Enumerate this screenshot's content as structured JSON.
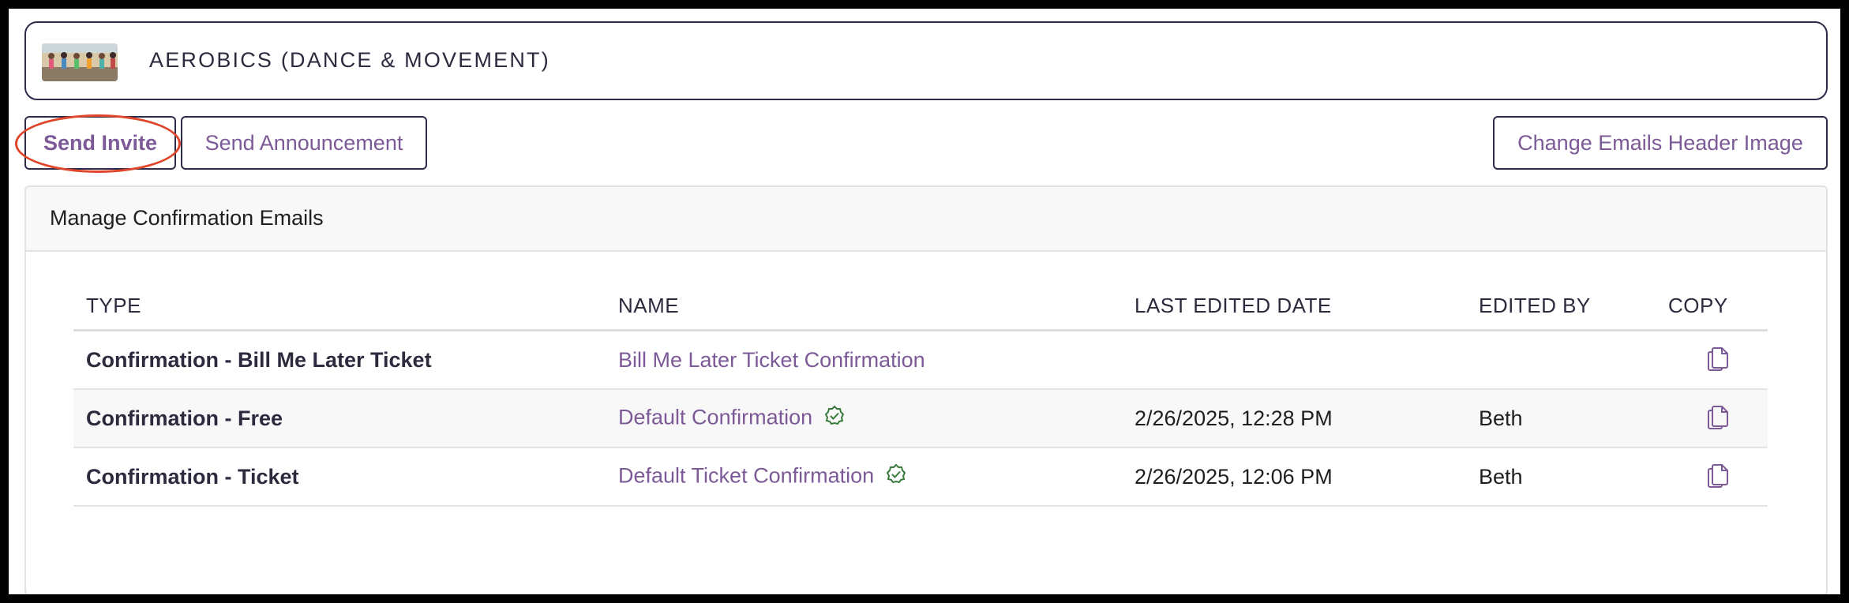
{
  "event": {
    "title": "AEROBICS (DANCE & MOVEMENT)",
    "thumbnail_icon": "event-photo-thumbnail"
  },
  "toolbar": {
    "send_invite_label": "Send Invite",
    "send_announcement_label": "Send Announcement",
    "change_header_image_label": "Change Emails Header Image"
  },
  "panel": {
    "title": "Manage Confirmation Emails"
  },
  "table": {
    "columns": [
      "TYPE",
      "NAME",
      "LAST EDITED DATE",
      "EDITED BY",
      "COPY"
    ],
    "rows": [
      {
        "type": "Confirmation - Bill Me Later Ticket",
        "name": "Bill Me Later Ticket Confirmation",
        "date": "",
        "edited_by": "",
        "default": false
      },
      {
        "type": "Confirmation - Free",
        "name": "Default Confirmation",
        "date": "2/26/2025, 12:28 PM",
        "edited_by": "Beth",
        "default": true
      },
      {
        "type": "Confirmation - Ticket",
        "name": "Default Ticket Confirmation",
        "date": "2/26/2025, 12:06 PM",
        "edited_by": "Beth",
        "default": true
      }
    ]
  },
  "colors": {
    "accent": "#7c5a97",
    "border_dark": "#2d2a4a",
    "highlight_circle": "#e0452a",
    "verified": "#3a7a3a"
  }
}
